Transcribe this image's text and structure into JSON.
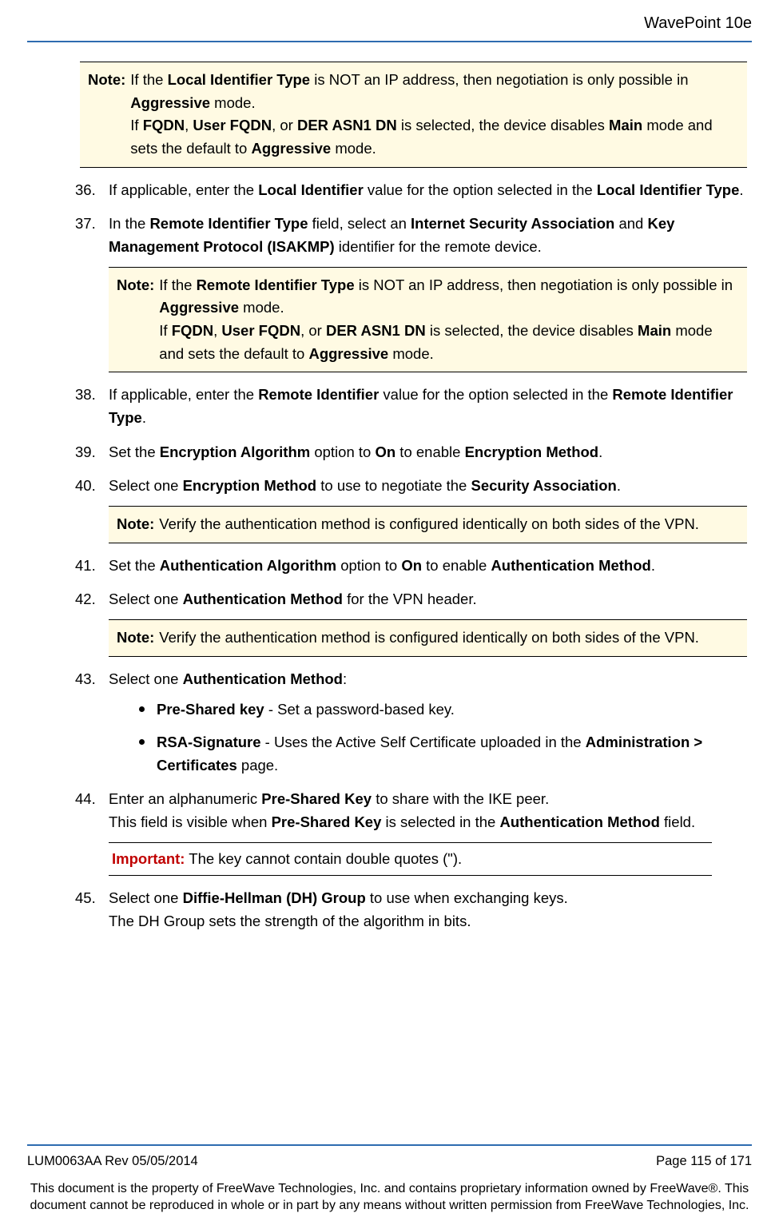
{
  "header": {
    "title": "WavePoint 10e"
  },
  "notes": {
    "label": "Note:",
    "n1a": "If the <b>Local Identifier Type</b> is NOT an IP address, then negotiation is only possible in <b>Aggressive</b> mode.",
    "n1b": "If <b>FQDN</b>, <b>User FQDN</b>, or <b>DER ASN1 DN</b> is selected, the device disables <b>Main</b> mode and sets the default to <b>Aggressive</b> mode.",
    "n2a": "If the <b>Remote Identifier Type</b> is NOT an IP address, then negotiation is only possible in <b>Aggressive</b> mode.",
    "n2b": "If <b>FQDN</b>, <b>User FQDN</b>, or <b>DER ASN1 DN</b> is selected, the device disables <b>Main</b> mode and sets the default to <b>Aggressive</b> mode.",
    "n3": "Verify the authentication method is configured identically on both sides of the VPN.",
    "n4": "Verify the authentication method is configured identically on both sides of the VPN."
  },
  "steps": {
    "s36": {
      "num": "36.",
      "text": "If applicable, enter the <b>Local Identifier</b> value for the option selected in the <b>Local Identifier Type</b>."
    },
    "s37": {
      "num": "37.",
      "text": "In the <b>Remote Identifier Type</b> field, select an <b>Internet Security Association</b> and <b>Key Management Protocol (ISAKMP)</b> identifier for the remote device."
    },
    "s38": {
      "num": "38.",
      "text": "If applicable, enter the <b>Remote Identifier</b> value for the option selected in the <b>Remote Identifier Type</b>."
    },
    "s39": {
      "num": "39.",
      "text": "Set the <b>Encryption Algorithm</b> option to <b>On</b> to enable  <b>Encryption Method</b>."
    },
    "s40": {
      "num": "40.",
      "text": "Select one  <b>Encryption Method</b> to use to negotiate the <b>Security Association</b>."
    },
    "s41": {
      "num": "41.",
      "text": "Set the <b>Authentication Algorithm</b> option to <b>On</b> to enable <b>Authentication Method</b>."
    },
    "s42": {
      "num": "42.",
      "text": "Select one <b>Authentication Method</b> for the VPN header."
    },
    "s43": {
      "num": "43.",
      "text": "Select one <b>Authentication Method</b>:",
      "b1": "<b>Pre-Shared key</b> - Set a password-based key.",
      "b2": "<b>RSA-Signature</b> - Uses the Active Self Certificate uploaded in the <b>Administration > Certificates</b> page."
    },
    "s44": {
      "num": "44.",
      "p1": "Enter an alphanumeric <b>Pre-Shared Key</b> to share with the IKE peer.",
      "p2": "This field is visible when <b>Pre-Shared Key</b> is selected in the <b>Authentication Method</b> field."
    },
    "s45": {
      "num": "45.",
      "p1": "Select one <b>Diffie-Hellman (DH) Group</b> to use when exchanging keys.",
      "p2": "The DH Group sets the strength of the algorithm in bits."
    }
  },
  "important": {
    "label": "Important:",
    "text": "The key cannot contain double quotes (\")."
  },
  "footer": {
    "left": "LUM0063AA Rev 05/05/2014",
    "right": "Page 115 of 171",
    "notice": "This document is the property of FreeWave Technologies, Inc. and contains proprietary information owned by FreeWave®. This document cannot be reproduced in whole or in part by any means without written permission from FreeWave Technologies, Inc."
  }
}
